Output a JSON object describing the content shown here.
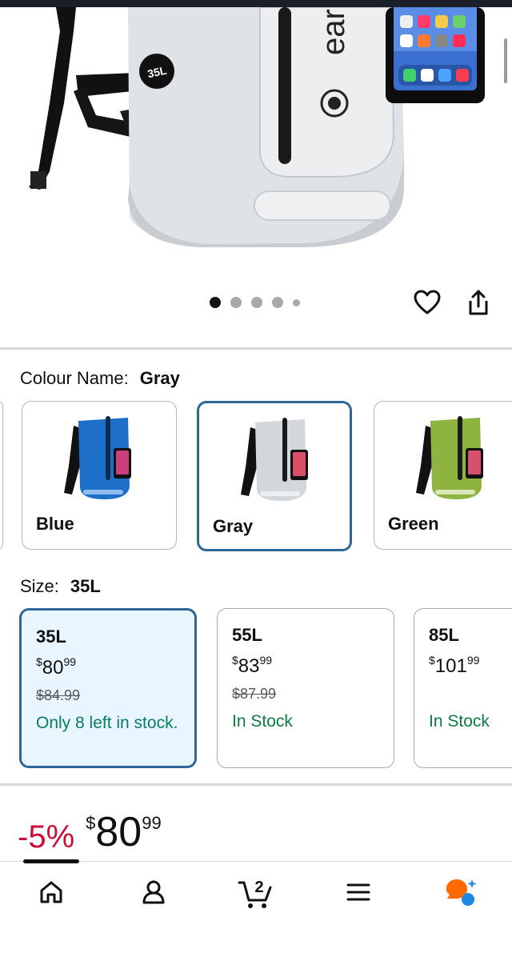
{
  "product": {
    "image_alt": "Gray 35L dry bag backpack with phone pouch",
    "bag_size_tag": "35L",
    "brand_fragment": "ear"
  },
  "carousel": {
    "image_count": 5,
    "active_index": 0
  },
  "colour": {
    "label": "Colour Name:",
    "selected": "Gray",
    "options": [
      {
        "name": "Blue",
        "color": "#1e6fc7",
        "selected": false
      },
      {
        "name": "Gray",
        "color": "#d3d6da",
        "selected": true
      },
      {
        "name": "Green",
        "color": "#8fb33f",
        "selected": false
      }
    ]
  },
  "size": {
    "label": "Size:",
    "selected": "35L",
    "options": [
      {
        "size": "35L",
        "price_whole": "80",
        "price_fraction": "99",
        "currency": "$",
        "was_price": "$84.99",
        "stock": "Only 8 left in stock.",
        "selected": true
      },
      {
        "size": "55L",
        "price_whole": "83",
        "price_fraction": "99",
        "currency": "$",
        "was_price": "$87.99",
        "stock": "In Stock",
        "selected": false
      },
      {
        "size": "85L",
        "price_whole": "101",
        "price_fraction": "99",
        "currency": "$",
        "was_price": "",
        "stock": "In Stock",
        "selected": false
      }
    ]
  },
  "buybox": {
    "discount": "-5%",
    "currency": "$",
    "price_whole": "80",
    "price_fraction": "99"
  },
  "nav": {
    "cart_count": "2",
    "items": [
      "home-icon",
      "account-icon",
      "cart-icon",
      "menu-icon",
      "assistant-icon"
    ]
  },
  "colors": {
    "accent_border": "#2e6696",
    "selected_bg": "#eaf6ff",
    "stock_green": "#067d62",
    "discount_red": "#cc0c39",
    "assistant_orange": "#ff6a00",
    "assistant_blue": "#1e88e5"
  }
}
